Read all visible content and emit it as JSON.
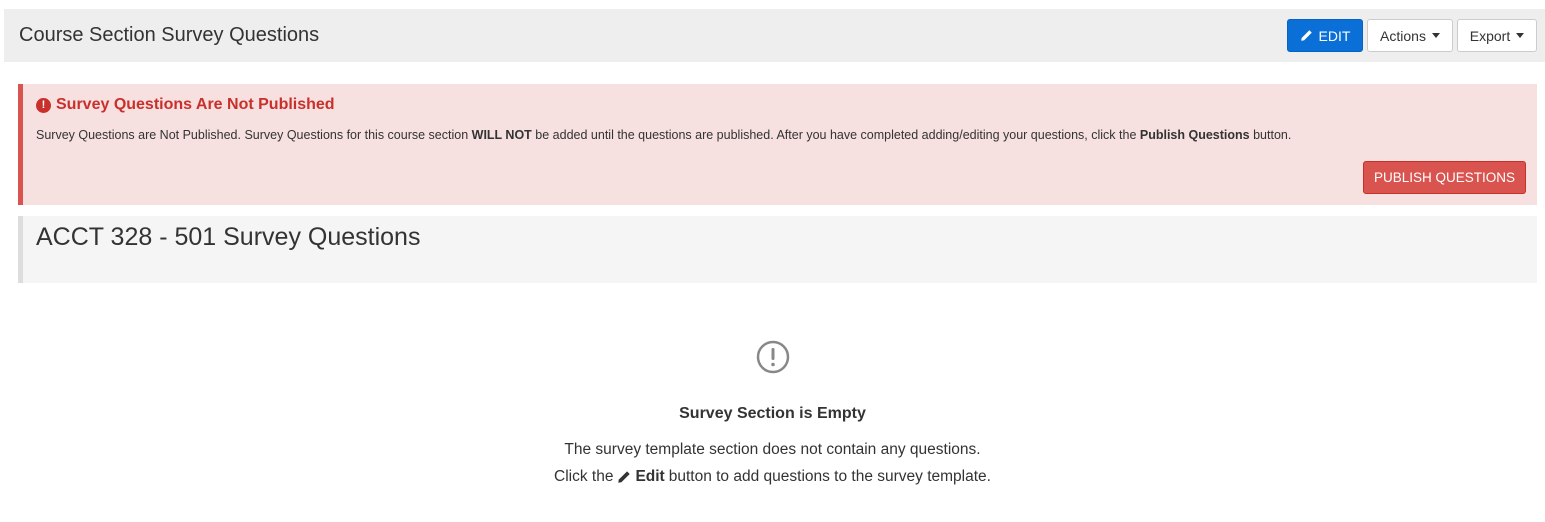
{
  "header": {
    "title": "Course Section Survey Questions",
    "edit_label": "EDIT",
    "actions_label": "Actions",
    "export_label": "Export"
  },
  "alert": {
    "title": "Survey Questions Are Not Published",
    "message_part1": "Survey Questions are Not Published. Survey Questions for this course section ",
    "message_bold1": "WILL NOT",
    "message_part2": " be added until the questions are published. After you have completed adding/editing your questions, click the ",
    "message_bold2": "Publish Questions",
    "message_part3": " button.",
    "publish_label": "PUBLISH QUESTIONS",
    "color": "#d9534f"
  },
  "section": {
    "title": "ACCT 328 - 501 Survey Questions"
  },
  "empty_state": {
    "icon": "exclamation-circle-icon",
    "title": "Survey Section is Empty",
    "line1": "The survey template section does not contain any questions.",
    "line2_prefix": "Click the",
    "line2_bold": "Edit",
    "line2_suffix": "button to add questions to the survey template."
  },
  "colors": {
    "primary": "#0a6fd6",
    "danger": "#d9534f",
    "header_bg": "#eeeeee"
  }
}
